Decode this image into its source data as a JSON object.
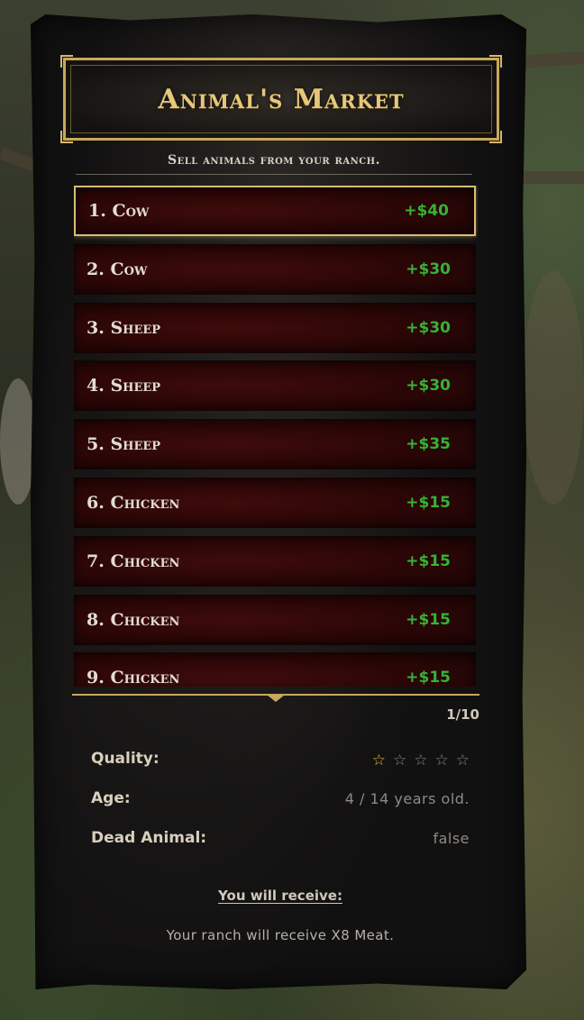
{
  "menu": {
    "title": "Animal's Market",
    "subtitle": "Sell animals from your ranch."
  },
  "animals": [
    {
      "label": "1. Cow",
      "price": "+$40",
      "selected": true
    },
    {
      "label": "2. Cow",
      "price": "+$30",
      "selected": false
    },
    {
      "label": "3. Sheep",
      "price": "+$30",
      "selected": false
    },
    {
      "label": "4. Sheep",
      "price": "+$30",
      "selected": false
    },
    {
      "label": "5. Sheep",
      "price": "+$35",
      "selected": false
    },
    {
      "label": "6. Chicken",
      "price": "+$15",
      "selected": false
    },
    {
      "label": "7. Chicken",
      "price": "+$15",
      "selected": false
    },
    {
      "label": "8. Chicken",
      "price": "+$15",
      "selected": false
    },
    {
      "label": "9. Chicken",
      "price": "+$15",
      "selected": false
    }
  ],
  "pagination": "1/10",
  "details": {
    "quality_label": "Quality:",
    "quality_stars": 1,
    "quality_max": 5,
    "age_label": "Age:",
    "age_value": "4 / 14 years old.",
    "dead_label": "Dead Animal:",
    "dead_value": "false"
  },
  "receive": {
    "title": "You will receive:",
    "text": "Your ranch will receive X8 Meat."
  },
  "colors": {
    "accent_gold": "#c9a85c",
    "price_green": "#36b236",
    "row_red": "#3f0b0b",
    "star_filled": "#e2b93a"
  }
}
